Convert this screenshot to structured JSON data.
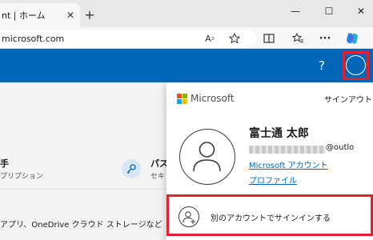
{
  "browser": {
    "tab_title": "nt | ホーム",
    "tab_close": "✕",
    "new_tab": "+",
    "window_buttons": {
      "minimize": "—",
      "maximize": "☐",
      "close": "✕"
    },
    "address": "microsoft.com"
  },
  "toolbar_icons": [
    "read-aloud-icon",
    "favorite-star-icon",
    "split-screen-icon",
    "favorites-icon",
    "more-icon",
    "copilot-icon"
  ],
  "header": {
    "help_label": "?"
  },
  "page": {
    "card1_title": "手",
    "card1_sub": "プリプション",
    "card2_title": "パス",
    "card2_sub": "セキ",
    "bottom_text": "アプリ、OneDrive クラウド ストレージなど"
  },
  "flyout": {
    "brand": "Microsoft",
    "sign_out": "サインアウト",
    "user_name": "富士通 太郎",
    "email_domain": "@outlo",
    "link_account": "Microsoft アカウント",
    "link_profile": "プロファイル",
    "switch_account": "別のアカウントでサインインする"
  },
  "colors": {
    "accent": "#0067b8",
    "highlight_border": "#e0212f",
    "logo": [
      "#f25022",
      "#7fba00",
      "#00a4ef",
      "#ffb900"
    ]
  }
}
